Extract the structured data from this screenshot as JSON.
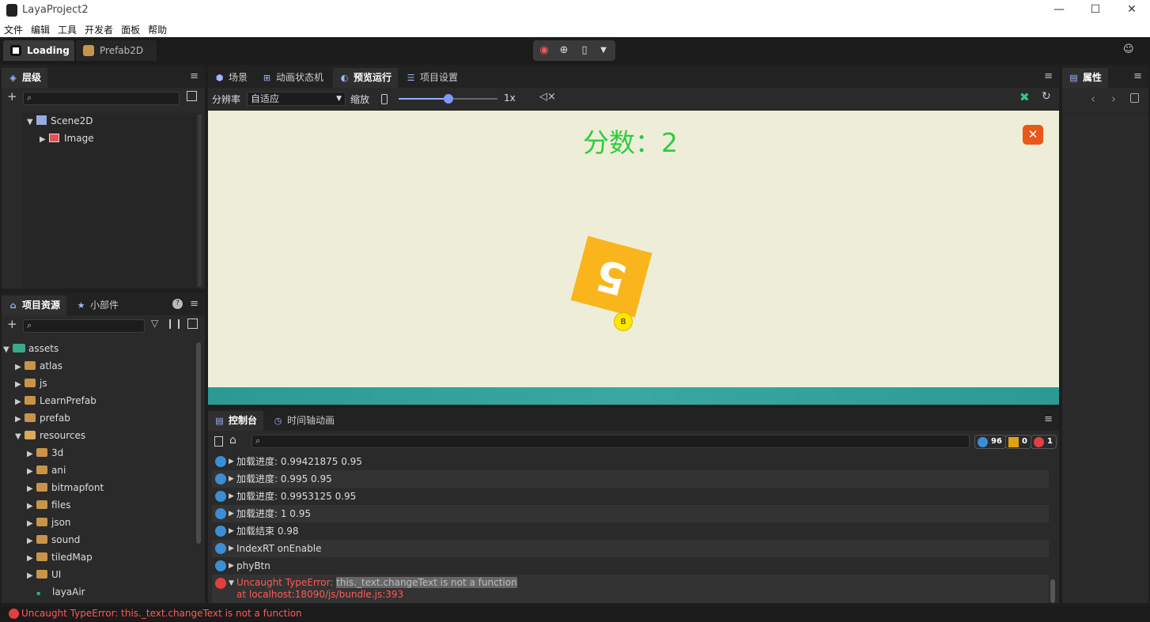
{
  "window": {
    "title": "LayaProject2",
    "min": "—",
    "max": "☐",
    "close": "✕"
  },
  "menu": [
    "文件",
    "编辑",
    "工具",
    "开发者",
    "面板",
    "帮助"
  ],
  "doc_tabs": [
    {
      "label": "Loading",
      "active": true
    },
    {
      "label": "Prefab2D",
      "active": false
    }
  ],
  "hierarchy": {
    "tab": "层级",
    "items": [
      {
        "label": "Scene2D"
      },
      {
        "label": "Image"
      }
    ]
  },
  "assets": {
    "tabs": [
      "项目资源",
      "小部件"
    ],
    "items": [
      {
        "label": "assets"
      },
      {
        "label": "atlas"
      },
      {
        "label": "js"
      },
      {
        "label": "LearnPrefab"
      },
      {
        "label": "prefab"
      },
      {
        "label": "resources"
      },
      {
        "label": "3d"
      },
      {
        "label": "ani"
      },
      {
        "label": "bitmapfont"
      },
      {
        "label": "files"
      },
      {
        "label": "json"
      },
      {
        "label": "sound"
      },
      {
        "label": "tiledMap"
      },
      {
        "label": "UI"
      },
      {
        "label": "layaAir"
      }
    ]
  },
  "center_tabs": [
    "场景",
    "动画状态机",
    "预览运行",
    "项目设置"
  ],
  "preview": {
    "resolution_label": "分辨率",
    "resolution_value": "自适应",
    "zoom_label": "缩放",
    "zoom_value": "1x",
    "zoom_fraction": 0.5,
    "score_text": "分数：2",
    "block_number": "5",
    "ball_label": "B",
    "colors": {
      "bg": "#eeeed8",
      "score": "#2ecc40",
      "block": "#f9b51b",
      "close": "#e8581a",
      "ball": "#ffe600",
      "ground": "#2a9a92"
    }
  },
  "properties": {
    "tab": "属性"
  },
  "console": {
    "tabs": [
      "控制台",
      "时间轴动画"
    ],
    "counts": {
      "info": "96",
      "warn": "0",
      "error": "1"
    },
    "logs": [
      {
        "text": "加载进度: 0.99421875 0.95"
      },
      {
        "text": "加载进度: 0.995 0.95"
      },
      {
        "text": "加载进度: 0.9953125 0.95"
      },
      {
        "text": "加载进度: 1 0.95"
      },
      {
        "text": "加载结束 0.98"
      },
      {
        "text": "IndexRT onEnable"
      },
      {
        "text": "phyBtn"
      }
    ],
    "error": {
      "prefix": "Uncaught TypeError:",
      "message": "this._text.changeText is not a function",
      "location": "at localhost:18090/js/bundle.js:393"
    }
  },
  "statusbar": {
    "text": "Uncaught TypeError: this._text.changeText is not a function"
  }
}
